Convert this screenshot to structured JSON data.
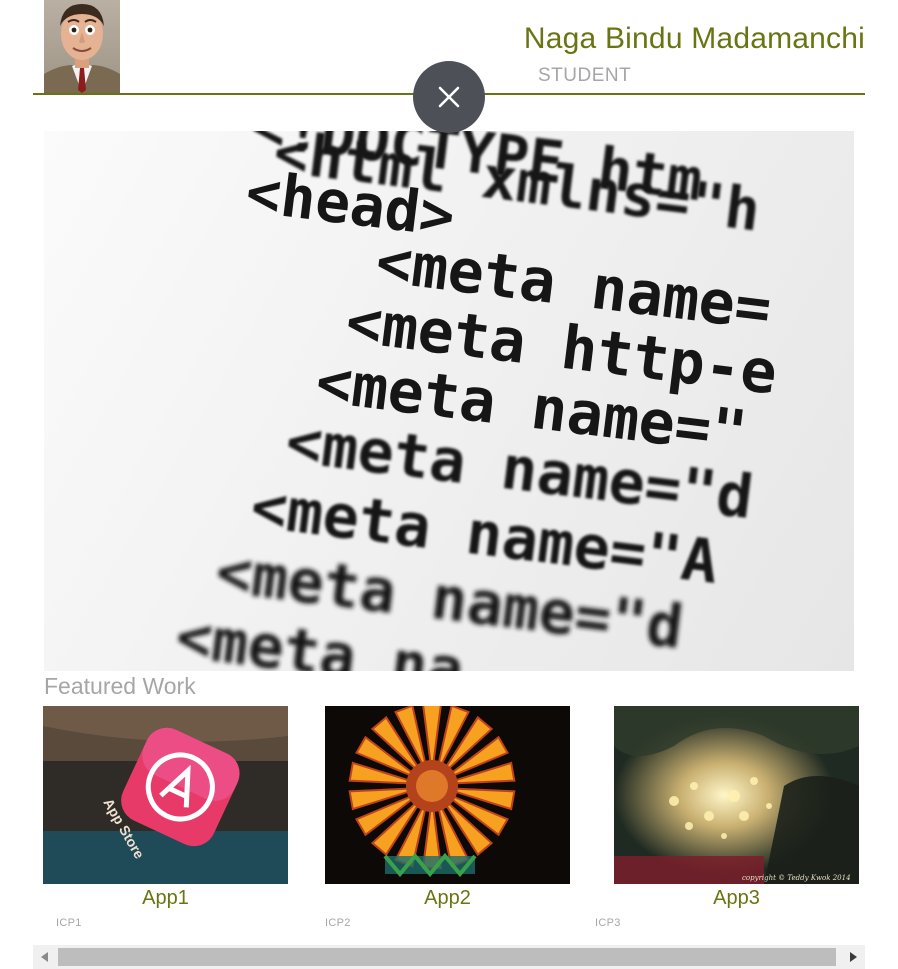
{
  "profile": {
    "name": "Naga Bindu Madamanchi",
    "role": "STUDENT",
    "avatar_icon": "person-photo"
  },
  "close_button": {
    "icon": "close-icon"
  },
  "hero": {
    "code_lines": [
      "<!DOCTYPE htm",
      "<html xmlns=\"h",
      "<head>",
      "<meta name=",
      "<meta http-e",
      "<meta name=\"",
      "<meta name=\"d",
      "<meta name=\"A",
      "<meta name=\"d",
      "<meta na"
    ]
  },
  "featured": {
    "heading": "Featured Work",
    "items": [
      {
        "title": "App1",
        "subtitle": "ICP1",
        "overlay_text": "App Store"
      },
      {
        "title": "App2",
        "subtitle": "ICP2",
        "overlay_text": ""
      },
      {
        "title": "App3",
        "subtitle": "ICP3",
        "overlay_text": "copyright © Teddy Kwok 2014"
      }
    ]
  },
  "scrollbar": {
    "left_icon": "chevron-left-icon",
    "right_icon": "chevron-right-icon"
  },
  "colors": {
    "accent": "#6b7412",
    "muted": "#a6a6a6",
    "close_bg": "#4d5056"
  }
}
